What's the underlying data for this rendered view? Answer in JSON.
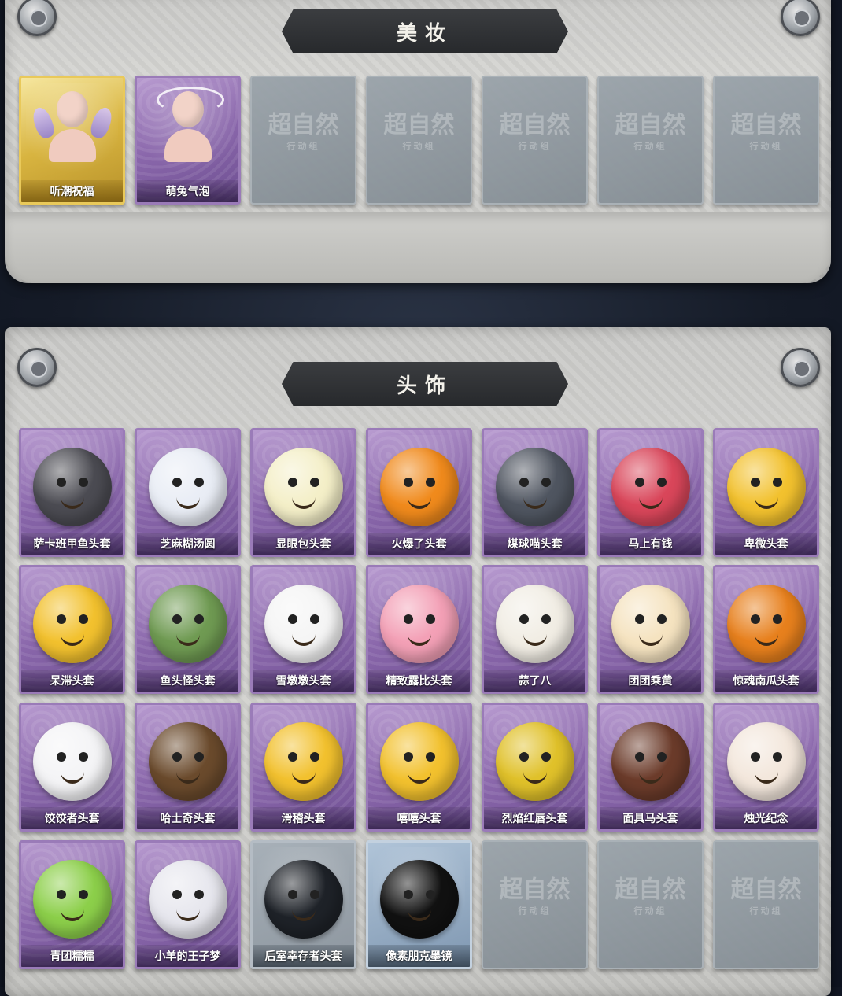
{
  "sections": {
    "makeup": {
      "title": "美妆",
      "items": [
        {
          "name": "听潮祝福",
          "rarity": "gold",
          "art": "doll-wings"
        },
        {
          "name": "萌兔气泡",
          "rarity": "purple",
          "art": "doll-halo"
        },
        {
          "name": "",
          "rarity": "empty"
        },
        {
          "name": "",
          "rarity": "empty"
        },
        {
          "name": "",
          "rarity": "empty"
        },
        {
          "name": "",
          "rarity": "empty"
        },
        {
          "name": "",
          "rarity": "empty"
        }
      ]
    },
    "headwear": {
      "title": "头饰",
      "items": [
        {
          "name": "萨卡班甲鱼头套",
          "rarity": "purple",
          "color": "#4b4b52"
        },
        {
          "name": "芝麻糊汤圆",
          "rarity": "purple",
          "color": "#e9edf5"
        },
        {
          "name": "显眼包头套",
          "rarity": "purple",
          "color": "#f4efc8"
        },
        {
          "name": "火爆了头套",
          "rarity": "purple",
          "color": "#f08a1c"
        },
        {
          "name": "煤球喵头套",
          "rarity": "purple",
          "color": "#4f5560"
        },
        {
          "name": "马上有钱",
          "rarity": "purple",
          "color": "#d9465a"
        },
        {
          "name": "卑微头套",
          "rarity": "purple",
          "color": "#f2c12e"
        },
        {
          "name": "呆滞头套",
          "rarity": "purple",
          "color": "#f2c12e"
        },
        {
          "name": "鱼头怪头套",
          "rarity": "purple",
          "color": "#6f9a52"
        },
        {
          "name": "雪墩墩头套",
          "rarity": "purple",
          "color": "#f5f5f5"
        },
        {
          "name": "精致露比头套",
          "rarity": "purple",
          "color": "#f3a0b6"
        },
        {
          "name": "蒜了八",
          "rarity": "purple",
          "color": "#f1ede4"
        },
        {
          "name": "团团乘黄",
          "rarity": "purple",
          "color": "#f5e3c0"
        },
        {
          "name": "惊魂南瓜头套",
          "rarity": "purple",
          "color": "#e7801d"
        },
        {
          "name": "饺饺者头套",
          "rarity": "purple",
          "color": "#f4f4f6"
        },
        {
          "name": "哈士奇头套",
          "rarity": "purple",
          "color": "#6a4a2c"
        },
        {
          "name": "滑稽头套",
          "rarity": "purple",
          "color": "#f2c12e"
        },
        {
          "name": "嘻嘻头套",
          "rarity": "purple",
          "color": "#f2c12e"
        },
        {
          "name": "烈焰红唇头套",
          "rarity": "purple",
          "color": "#e0c12a"
        },
        {
          "name": "面具马头套",
          "rarity": "purple",
          "color": "#6b3b2a"
        },
        {
          "name": "烛光纪念",
          "rarity": "purple",
          "color": "#f3e7dc"
        },
        {
          "name": "青团糯糯",
          "rarity": "purple",
          "color": "#8ccf4a"
        },
        {
          "name": "小羊的王子梦",
          "rarity": "purple",
          "color": "#e7e7ee"
        },
        {
          "name": "后室幸存者头套",
          "rarity": "gray",
          "color": "#1e2228"
        },
        {
          "name": "像素朋克墨镜",
          "rarity": "blue",
          "color": "#111111"
        },
        {
          "name": "",
          "rarity": "empty"
        },
        {
          "name": "",
          "rarity": "empty"
        },
        {
          "name": "",
          "rarity": "empty"
        }
      ]
    }
  },
  "empty_watermark": {
    "main": "超自然",
    "sub": "行动组"
  }
}
